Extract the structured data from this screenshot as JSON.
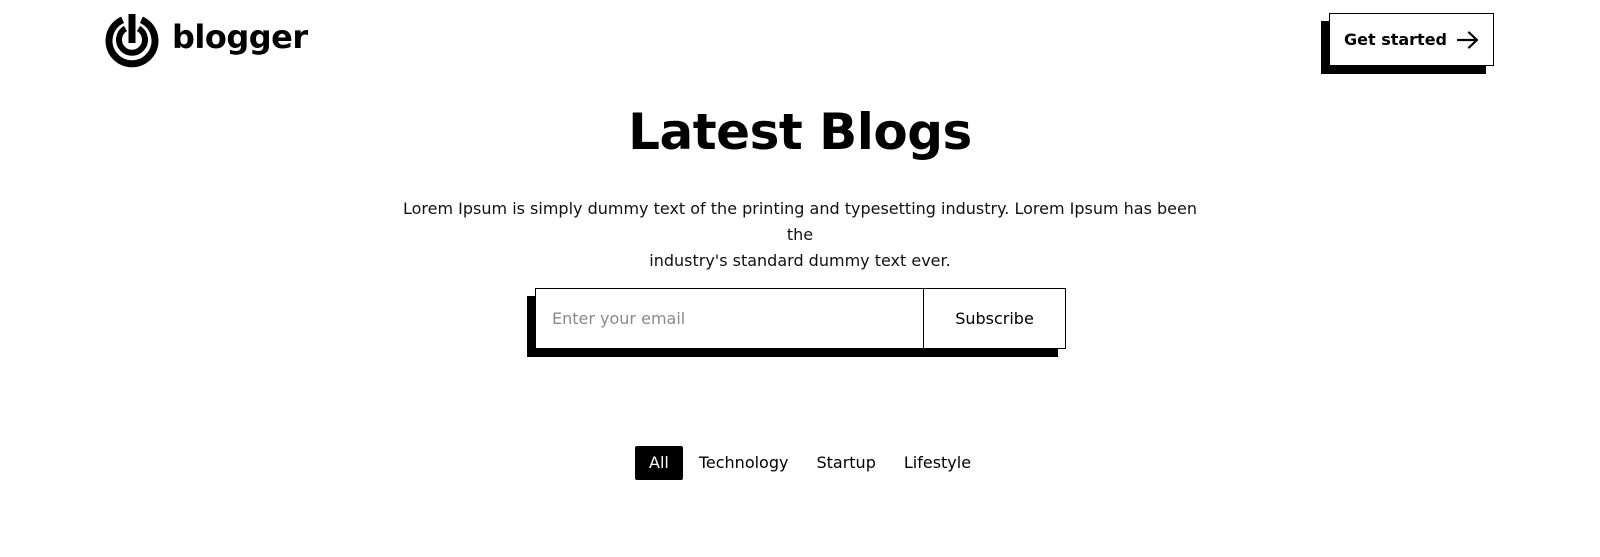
{
  "brand": {
    "name": "blogger",
    "logo_icon": "target-power-icon"
  },
  "header": {
    "cta_label": "Get started",
    "cta_icon": "arrow-right-icon"
  },
  "hero": {
    "title": "Latest Blogs",
    "description_line1": "Lorem Ipsum is simply dummy text of the printing and typesetting industry. Lorem Ipsum has been the",
    "description_line2": "industry's standard dummy text ever."
  },
  "subscribe": {
    "email_value": "",
    "email_placeholder": "Enter your email",
    "button_label": "Subscribe"
  },
  "filters": {
    "active_index": 0,
    "tabs": [
      {
        "label": "All"
      },
      {
        "label": "Technology"
      },
      {
        "label": "Startup"
      },
      {
        "label": "Lifestyle"
      }
    ]
  },
  "colors": {
    "background": "#ffffff",
    "foreground": "#000000",
    "placeholder": "#8a8a8a"
  }
}
